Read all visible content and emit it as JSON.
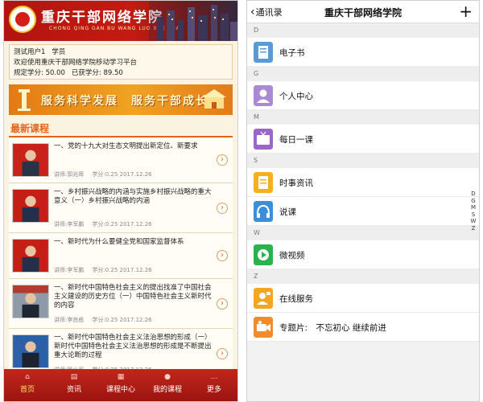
{
  "left": {
    "banner": {
      "title": "重庆干部网络学院",
      "subtitle": "CHONG QING GAN BU WANG LUO XUE YUAN"
    },
    "user": {
      "name": "测试用户1",
      "role": "学员",
      "welcome": "欢迎使用重庆干部网络学院移动学习平台",
      "required_credits": "规定学分: 50.00",
      "earned_credits": "已获学分: 89.50"
    },
    "slogan": "服务科学发展　服务干部成长",
    "section_title": "最新课程",
    "courses": [
      {
        "title": "一、党的十九大对生态文明提出新定位、新要求",
        "lecturer": "讲师:郭兆晖",
        "credit": "学分:0.25 2017.12.26"
      },
      {
        "title": "一、乡村振兴战略的内涵与实施乡村振兴战略的重大意义（一）乡村振兴战略的内涵",
        "lecturer": "讲师:李军鹏",
        "credit": "学分:0.25 2017.12.26"
      },
      {
        "title": "一、新时代为什么要健全党和国家监督体系",
        "lecturer": "讲师:李军鹏",
        "credit": "学分:0.25 2017.12.26"
      },
      {
        "title": "一、新时代中国特色社会主义的提出找准了中国社会主义建设的历史方位（一）中国特色社会主义新时代的内容",
        "lecturer": "讲师:李良栋",
        "credit": "学分:0.25 2017.12.26"
      },
      {
        "title": "一、新时代中国特色社会主义法治思想的形成（一）新时代中国特色社会主义法治思想的形成是不断提出重大论断的过程",
        "lecturer": "讲师:杨小军",
        "credit": "学分:0.25 2017.12.26"
      }
    ],
    "tabs": [
      "首页",
      "资讯",
      "课程中心",
      "我的课程",
      "更多"
    ]
  },
  "right": {
    "nav": {
      "back": "通讯录",
      "title": "重庆干部网络学院",
      "plus": "+"
    },
    "groups": [
      {
        "letter": "D",
        "items": [
          {
            "label": "电子书",
            "icon": "book-icon",
            "color": "#5b9bd5"
          }
        ]
      },
      {
        "letter": "G",
        "items": [
          {
            "label": "个人中心",
            "icon": "person-icon",
            "color": "#a98ad6"
          }
        ]
      },
      {
        "letter": "M",
        "items": [
          {
            "label": "每日一课",
            "icon": "tv-icon",
            "color": "#9a66c8"
          }
        ]
      },
      {
        "letter": "S",
        "items": [
          {
            "label": "时事资讯",
            "icon": "news-icon",
            "color": "#f3b21b"
          },
          {
            "label": "说课",
            "icon": "headphones-icon",
            "color": "#3a8fd8"
          }
        ]
      },
      {
        "letter": "W",
        "items": [
          {
            "label": "微视频",
            "icon": "play-icon",
            "color": "#2bb24c"
          }
        ]
      },
      {
        "letter": "Z",
        "items": [
          {
            "label": "在线服务",
            "icon": "service-icon",
            "color": "#f3a620"
          },
          {
            "label": "专题片:　不忘初心 继续前进",
            "icon": "camera-icon",
            "color": "#f08c2e"
          }
        ]
      }
    ],
    "index_letters": [
      "D",
      "G",
      "M",
      "S",
      "W",
      "Z"
    ]
  }
}
